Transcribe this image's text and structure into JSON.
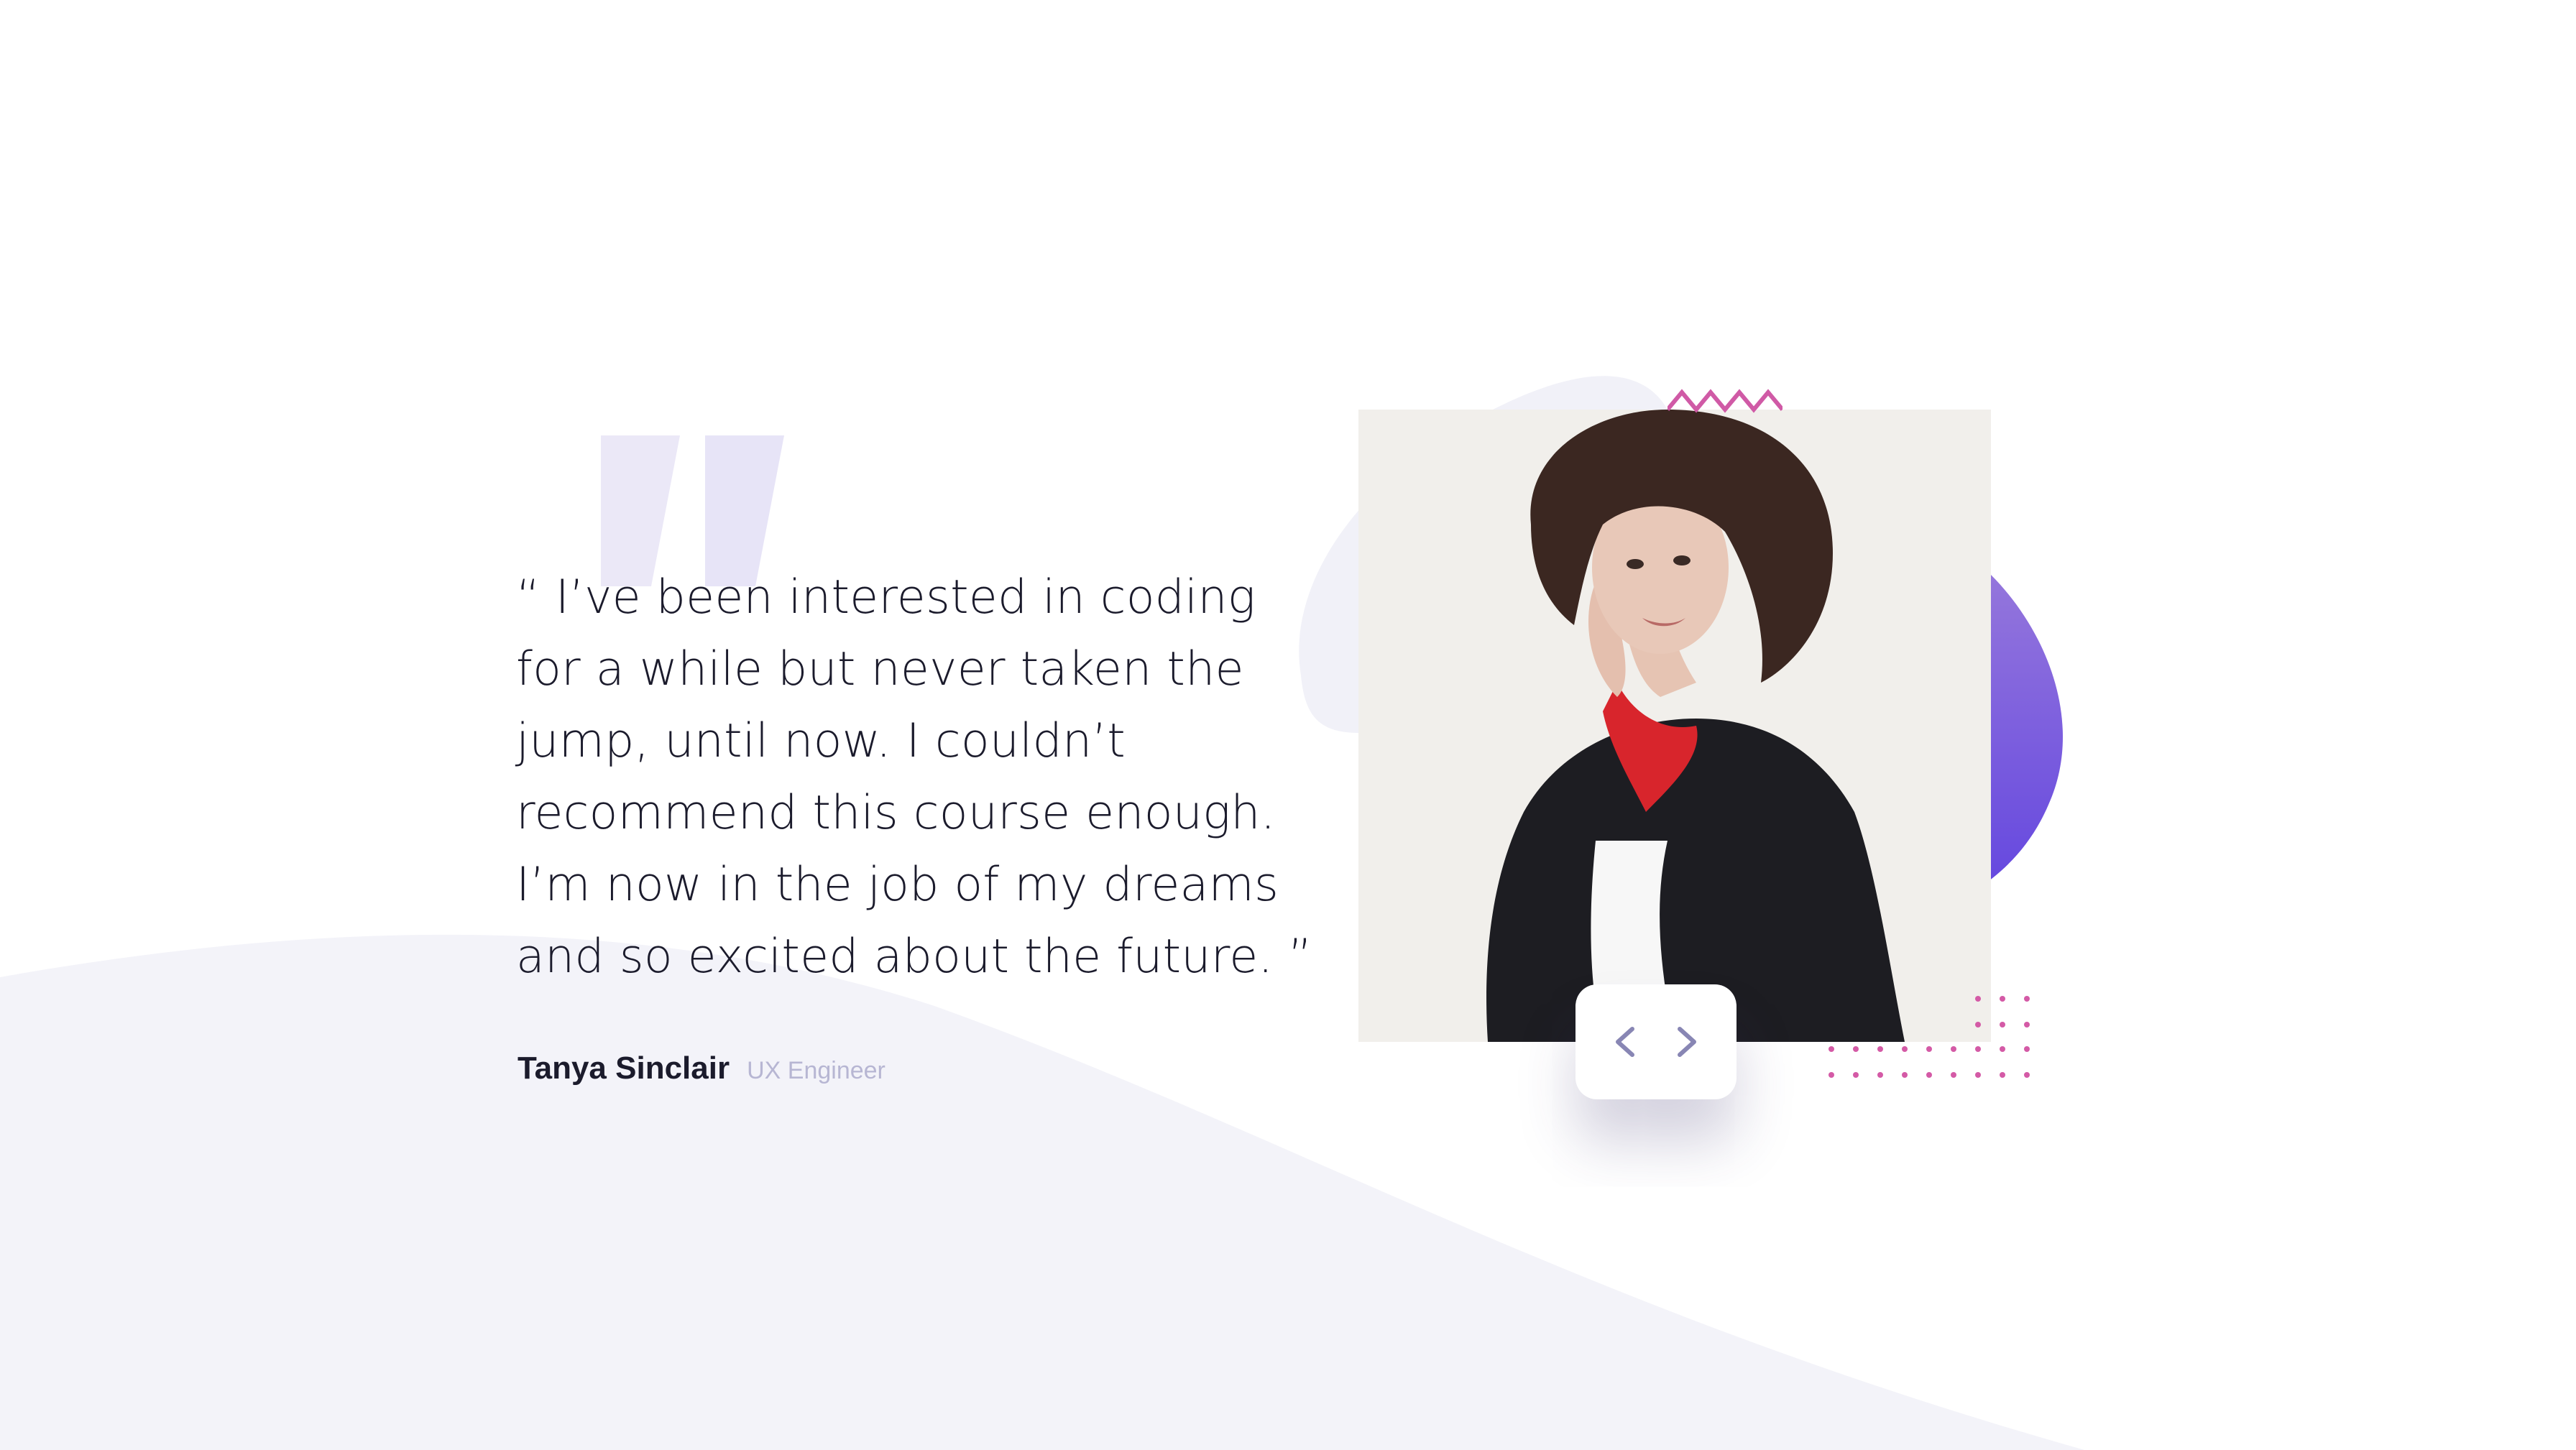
{
  "testimonial": {
    "quote": "“ I’ve been interested in coding for a while but never taken the jump, until now. I couldn’t recommend this course enough. I’m now in the job of my dreams and so excited about the future. ”",
    "author_name": "Tanya Sinclair",
    "author_role": "UX Engineer",
    "photo_alt": "Tanya Sinclair"
  },
  "controls": {
    "prev_icon": "chevron-left-icon",
    "next_icon": "chevron-right-icon"
  },
  "colors": {
    "text_dark": "#1b1b2c",
    "text_muted": "#b7b6d3",
    "accent_purple": "#6b4fd8",
    "accent_pink": "#cc5aa0",
    "quote_mark": "#e6e3f6",
    "background_wave": "#f3f3f9"
  }
}
